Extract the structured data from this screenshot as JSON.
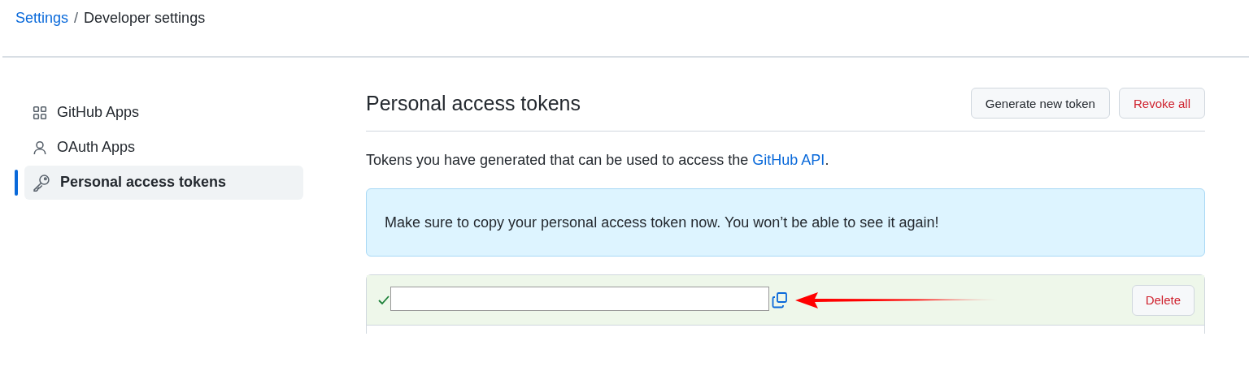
{
  "breadcrumb": {
    "link": "Settings",
    "separator": "/",
    "current": "Developer settings"
  },
  "sidebar": {
    "items": [
      {
        "label": "GitHub Apps",
        "kind": "apps",
        "selected": false
      },
      {
        "label": "OAuth Apps",
        "kind": "person",
        "selected": false
      },
      {
        "label": "Personal access tokens",
        "kind": "key",
        "selected": true
      }
    ]
  },
  "header": {
    "title": "Personal access tokens",
    "buttons": [
      {
        "label": "Generate new token",
        "kind": "default"
      },
      {
        "label": "Revoke all",
        "kind": "danger"
      }
    ]
  },
  "description": {
    "text": "Tokens you have generated that can be used to access the ",
    "link": "GitHub API",
    "end": "."
  },
  "flash": {
    "text": "Make sure to copy your personal access token now. You won’t be able to see it again!"
  },
  "token": {
    "checked": true,
    "delete_label": "Delete"
  }
}
